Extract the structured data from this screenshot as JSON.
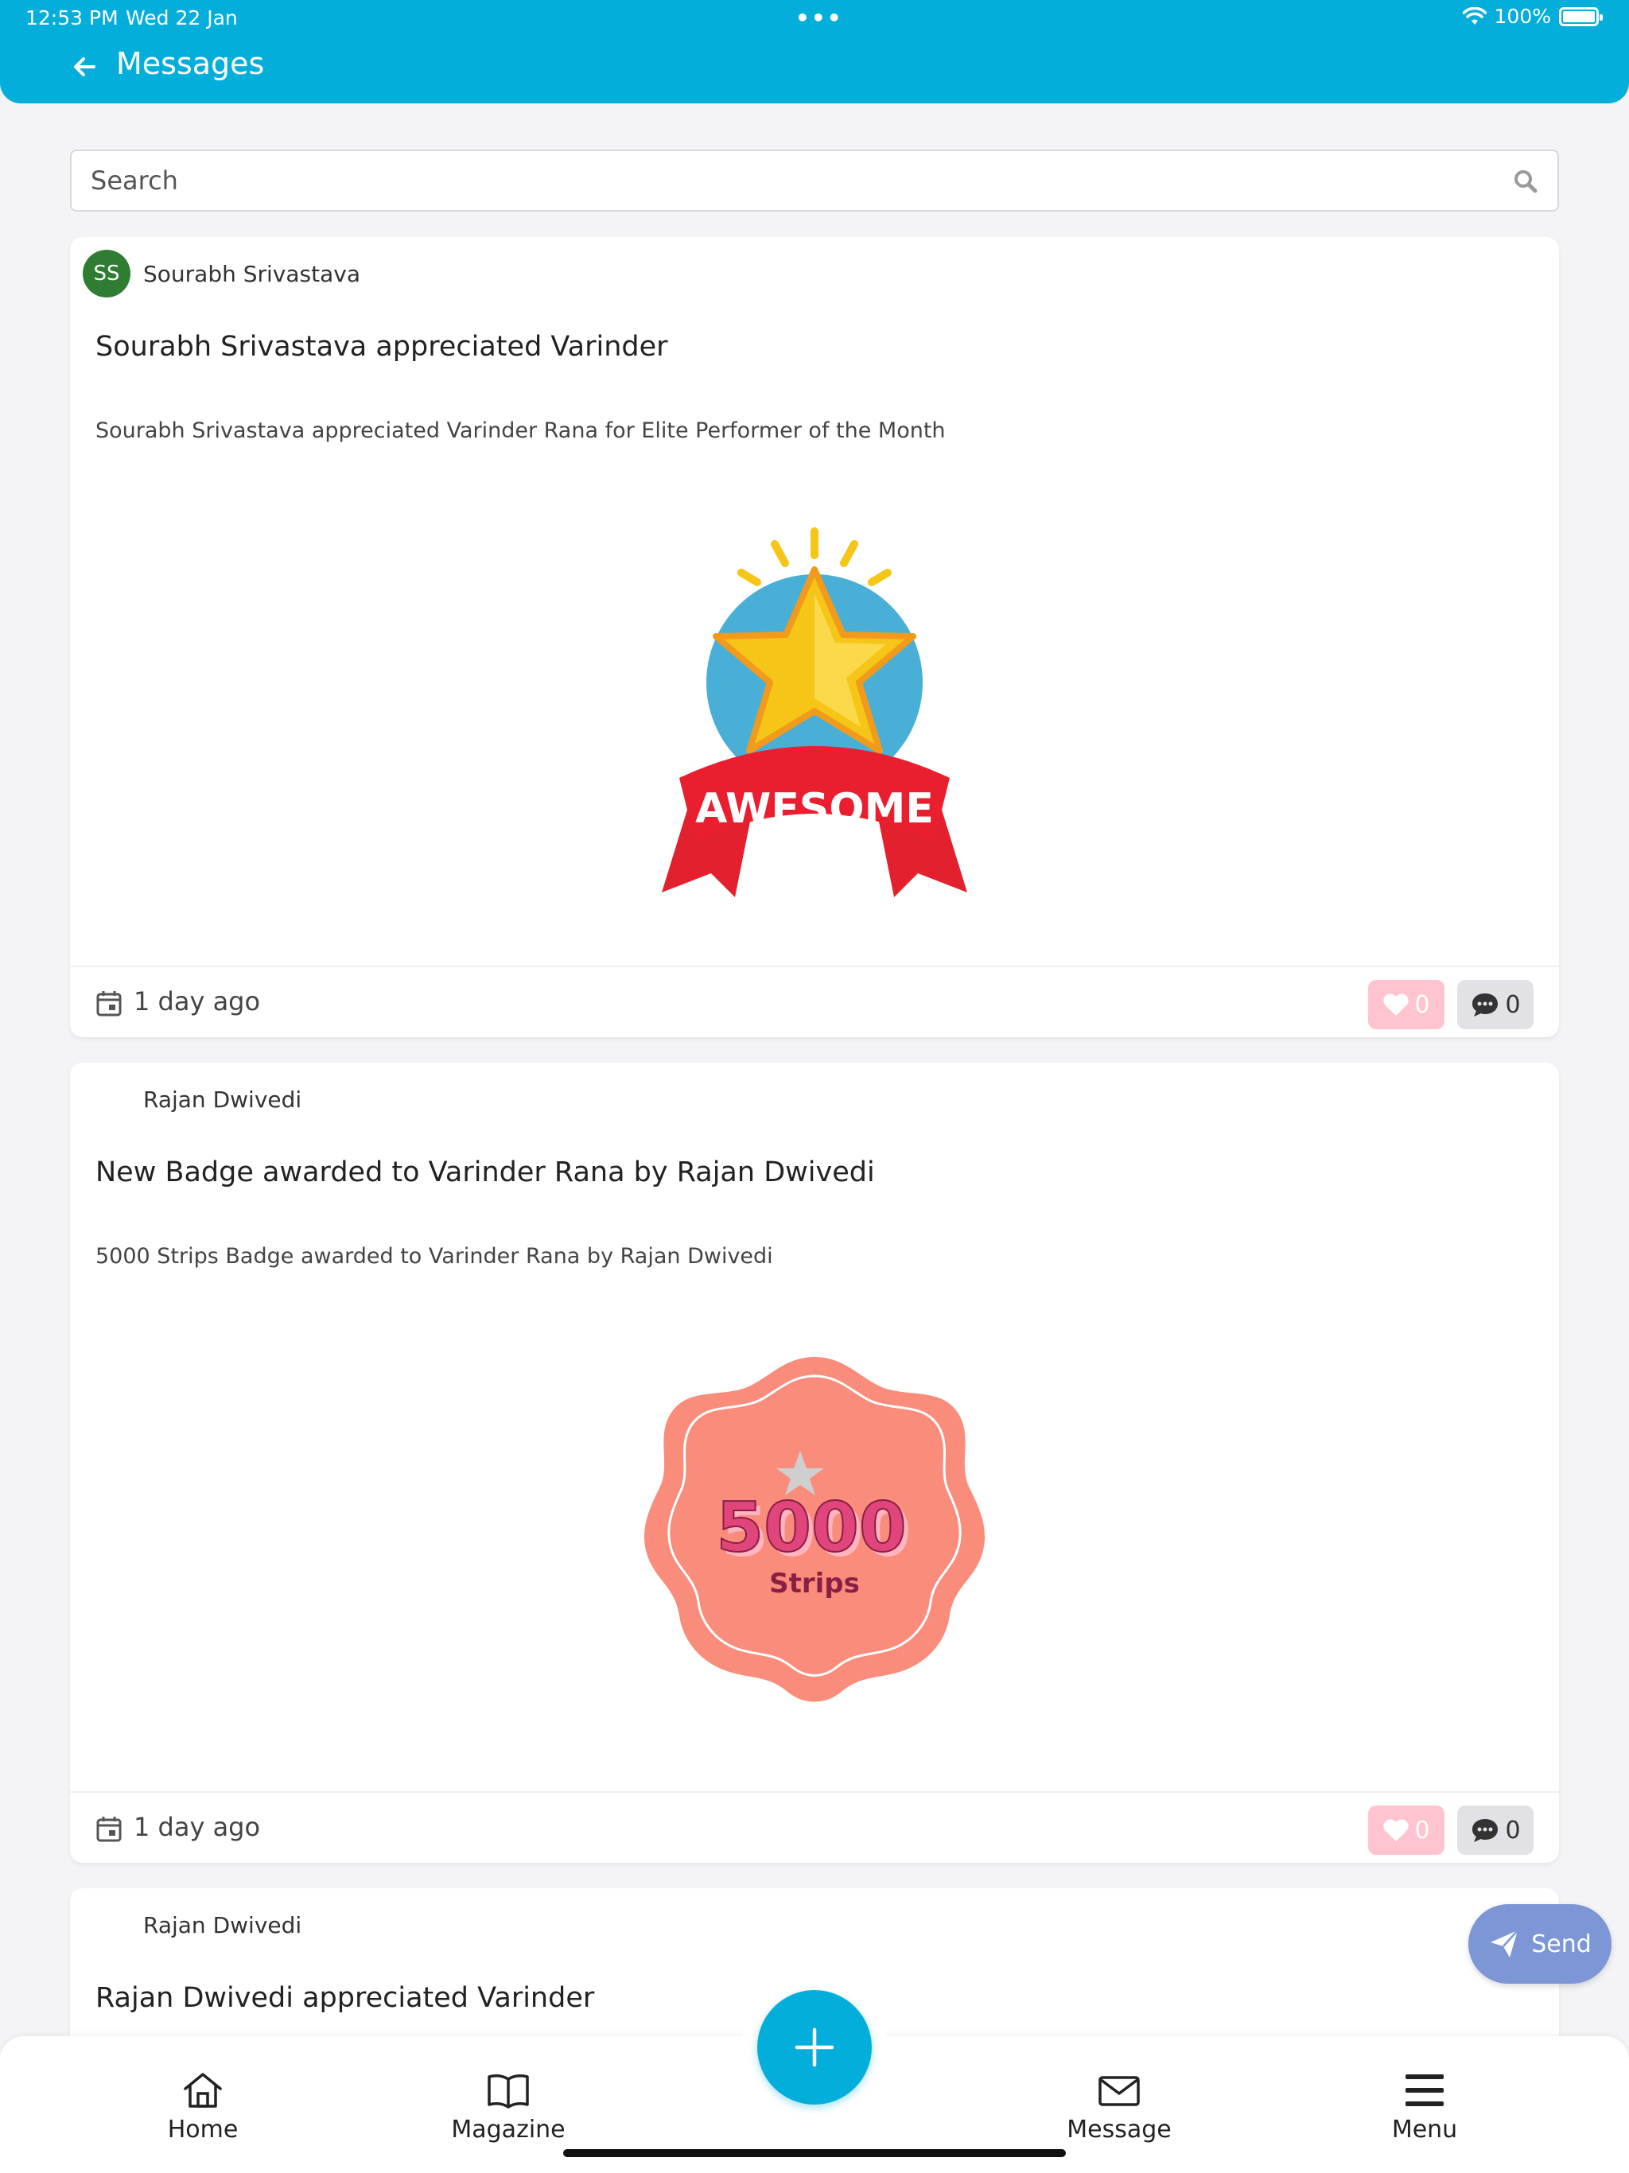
{
  "status_bar": {
    "time": "12:53 PM",
    "date": "Wed 22 Jan",
    "dots": "•••",
    "battery": "100%"
  },
  "header": {
    "title": "Messages"
  },
  "search": {
    "placeholder": "Search"
  },
  "posts": [
    {
      "author": "Sourabh Srivastava",
      "avatar_initials": "SS",
      "title": "Sourabh Srivastava appreciated Varinder",
      "description": "Sourabh Srivastava appreciated Varinder Rana for Elite Performer of the Month",
      "image_text": "AWESOME",
      "timestamp": "1 day ago",
      "likes": "0",
      "comments": "0"
    },
    {
      "author": "Rajan Dwivedi",
      "title": "New Badge awarded to Varinder Rana by Rajan Dwivedi",
      "description": "5000 Strips Badge awarded to Varinder Rana by Rajan Dwivedi",
      "image_number": "5000",
      "image_text": "Strips",
      "timestamp": "1 day ago",
      "likes": "0",
      "comments": "0"
    },
    {
      "author": "Rajan Dwivedi",
      "title": "Rajan Dwivedi appreciated Varinder"
    }
  ],
  "send_button": {
    "label": "Send"
  },
  "bottom_nav": {
    "home": "Home",
    "magazine": "Magazine",
    "message": "Message",
    "menu": "Menu"
  },
  "colors": {
    "accent": "#04aedb",
    "avatar": "#2e7d32",
    "like_bg": "#ffc4d0",
    "send_bg": "#7d97d6"
  }
}
